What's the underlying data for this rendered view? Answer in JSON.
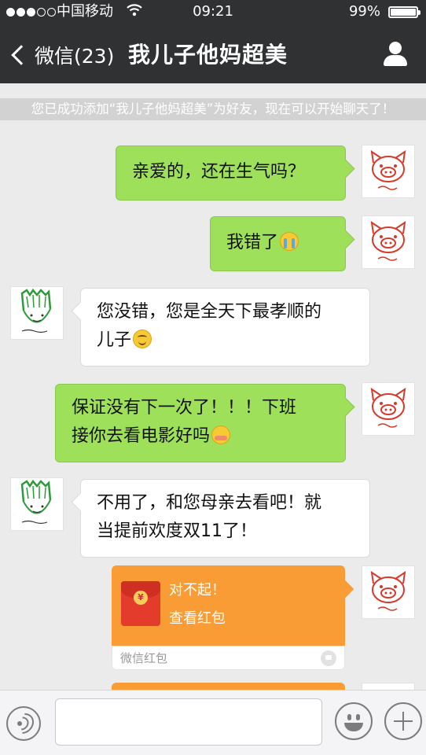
{
  "status_bar": {
    "carrier": "中国移动",
    "time": "09:21",
    "battery": "99%",
    "wifi_icon": "wifi-icon",
    "signal_icon": "signal-dots-icon"
  },
  "nav": {
    "back_label": "微信(23)",
    "title": "我儿子他妈超美",
    "back_icon": "chevron-left-icon",
    "profile_icon": "person-icon"
  },
  "system_notice": "您已成功添加“我儿子他妈超美”为好友，现在可以开始聊天了！",
  "messages": [
    {
      "side": "right",
      "text": "亲爱的，还在生气吗？",
      "emoji": null
    },
    {
      "side": "right",
      "text": "我错了",
      "emoji": "crying-emoji-icon"
    },
    {
      "side": "left",
      "line1": "您没错，您是全天下最孝顺的",
      "line2": "儿子",
      "emoji": "smile-emoji-icon"
    },
    {
      "side": "right",
      "line1": "保证没有下一次了！！！下班",
      "line2": "接你去看电影好吗",
      "emoji": "shy-emoji-icon"
    },
    {
      "side": "left",
      "line1": "不用了，和您母亲去看吧！就",
      "line2": "当提前欢度双11了！",
      "emoji": null
    }
  ],
  "red_packet": {
    "message": "对不起！",
    "action": "查看红包",
    "footer": "微信红包",
    "coin_symbol": "¥"
  },
  "colors": {
    "header_bg": "#2f3133",
    "chat_bg": "#ebebeb",
    "bubble_green": "#9fe05a",
    "red_packet_orange": "#f99c36"
  },
  "input_bar": {
    "voice_icon": "voice-icon",
    "emoji_icon": "emoji-face-icon",
    "plus_icon": "plus-icon",
    "text_value": ""
  }
}
